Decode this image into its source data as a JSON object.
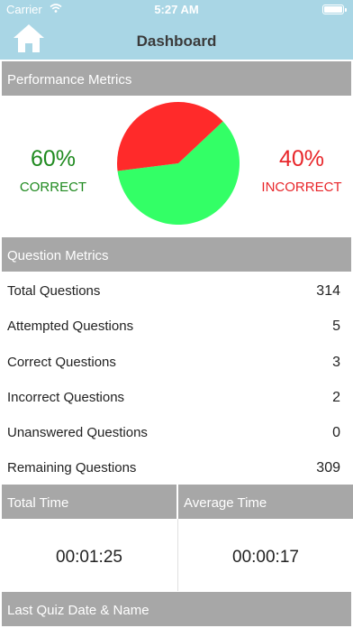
{
  "status_bar": {
    "carrier": "Carrier",
    "time": "5:27 AM",
    "wifi_icon": "wifi-icon",
    "battery_icon": "battery-icon"
  },
  "nav": {
    "title": "Dashboard",
    "home_icon": "home-icon"
  },
  "performance": {
    "header": "Performance Metrics",
    "correct_pct": "60%",
    "correct_label": "CORRECT",
    "incorrect_pct": "40%",
    "incorrect_label": "INCORRECT",
    "correct_fraction": 0.6,
    "incorrect_fraction": 0.4,
    "correct_color": "#33ff66",
    "incorrect_color": "#ff2a2a",
    "correct_text_color": "#1f8a1f",
    "incorrect_text_color": "#e8262a"
  },
  "question_metrics": {
    "header": "Question Metrics",
    "rows": [
      {
        "label": "Total Questions",
        "value": "314"
      },
      {
        "label": "Attempted Questions",
        "value": "5"
      },
      {
        "label": "Correct Questions",
        "value": "3"
      },
      {
        "label": "Incorrect Questions",
        "value": "2"
      },
      {
        "label": "Unanswered Questions",
        "value": "0"
      },
      {
        "label": "Remaining Questions",
        "value": "309"
      }
    ]
  },
  "time": {
    "total_label": "Total Time",
    "total_value": "00:01:25",
    "average_label": "Average Time",
    "average_value": "00:00:17"
  },
  "last_quiz": {
    "header": "Last Quiz Date & Name"
  },
  "colors": {
    "nav_bg": "#a9d6e5",
    "section_header_bg": "#a7a7a7"
  }
}
